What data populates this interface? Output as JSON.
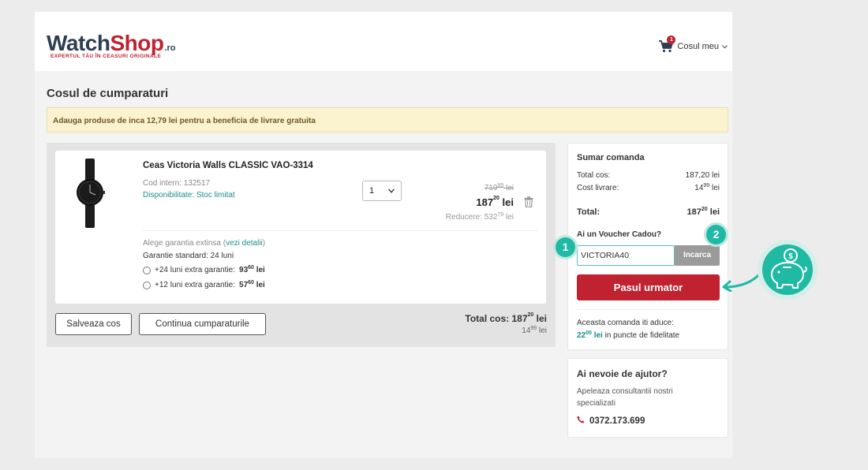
{
  "header": {
    "logo_watch": "Watch",
    "logo_shop": "Shop",
    "logo_tld": ".ro",
    "logo_tagline": "EXPERTUL TĂU ÎN CEASURI ORIGINALE",
    "cart_badge": "1",
    "cart_label": "Cosul meu"
  },
  "page_title": "Cosul de cumparaturi",
  "notice": "Adauga produse de inca 12,79 lei pentru a beneficia de livrare gratuita",
  "product": {
    "name": "Ceas Victoria Walls CLASSIC VAO-3314",
    "code": "Cod intern: 132517",
    "availability": "Disponibilitate: Stoc limitat",
    "quantity": "1",
    "old_price_int": "719",
    "old_price_dec": "99",
    "old_price_cur": "lei",
    "price_int": "187",
    "price_dec": "20",
    "price_cur": "lei",
    "discount_label": "Reducere: 532",
    "discount_dec": "79",
    "discount_cur": "lei",
    "warranty_prefix": "Alege garantia extinsa (",
    "warranty_link": "vezi detalii",
    "warranty_suffix": ")",
    "warranty_standard": "Garantie standard: 24 luni",
    "options": [
      {
        "label": "+24 luni extra garantie:",
        "int": "93",
        "dec": "60",
        "cur": "lei"
      },
      {
        "label": "+12 luni extra garantie:",
        "int": "57",
        "dec": "60",
        "cur": "lei"
      }
    ]
  },
  "actions": {
    "save_cart": "Salveaza cos",
    "continue_shopping": "Continua cumparaturile"
  },
  "cart_total": {
    "label": "Total cos: 187",
    "dec": "20",
    "cur": "lei",
    "ship_int": "14",
    "ship_dec": "99",
    "ship_cur": "lei"
  },
  "summary": {
    "title": "Sumar comanda",
    "total_cos_label": "Total cos:",
    "total_cos_value": "187,20 lei",
    "shipping_label": "Cost livrare:",
    "shipping_int": "14",
    "shipping_dec": "99",
    "shipping_cur": "lei",
    "total_label": "Total:",
    "total_int": "187",
    "total_dec": "20",
    "total_cur": "lei",
    "voucher_title": "Ai un Voucher Cadou?",
    "voucher_value": "VICTORIA40",
    "voucher_button": "Incarca",
    "next_button": "Pasul urmator",
    "loyalty_line1": "Aceasta comanda iti aduce:",
    "loyalty_int": "22",
    "loyalty_dec": "00",
    "loyalty_cur": "lei",
    "loyalty_suffix": "in puncte de fidelitate"
  },
  "help": {
    "title": "Ai nevoie de ajutor?",
    "text": "Apeleaza consultantii nostri specializati",
    "phone": "0372.173.699"
  },
  "annotations": {
    "marker1": "1",
    "marker2": "2"
  },
  "colors": {
    "brand_red": "#c0222f",
    "brand_navy": "#2c3e50",
    "teal": "#1fb9a4",
    "link_teal": "#1a8f8a"
  }
}
